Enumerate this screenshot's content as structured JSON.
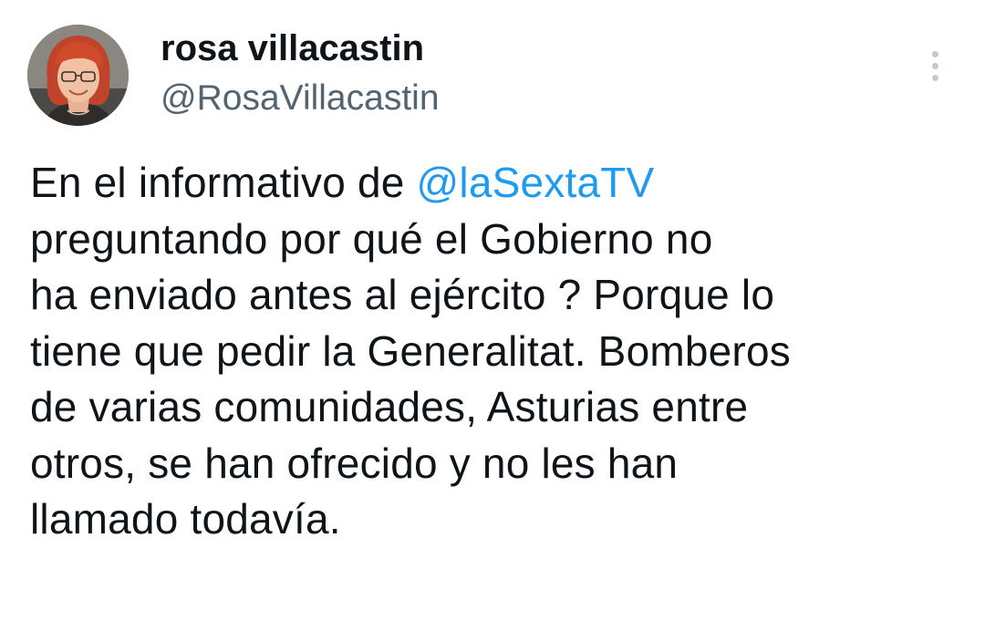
{
  "author": {
    "display_name": "rosa villacastin",
    "handle": "@RosaVillacastin"
  },
  "menu": {
    "icon": "more-vertical-icon"
  },
  "tweet": {
    "line1_prefix": "En el informativo de ",
    "line1_mention": "@laSextaTV",
    "lines": [
      "preguntando por qué el Gobierno no",
      "ha enviado antes al ejército ? Porque lo",
      "tiene que pedir la Generalitat. Bomberos",
      "de varias comunidades, Asturias entre",
      "otros, se han ofrecido y no les han",
      "llamado todavía."
    ]
  },
  "colors": {
    "text": "#0f1419",
    "secondary": "#536471",
    "link": "#1d9bf0",
    "menu_dots": "#c4c9cd"
  }
}
